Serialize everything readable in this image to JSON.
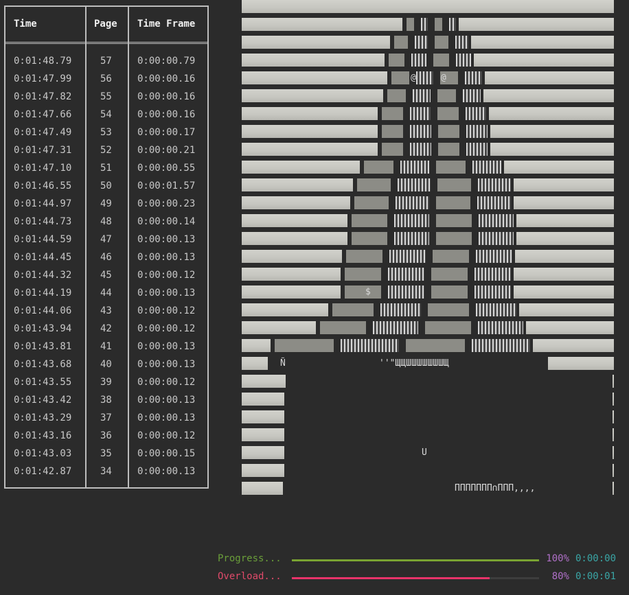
{
  "table": {
    "headers": {
      "time": "Time",
      "page": "Page",
      "frame": "Time Frame"
    },
    "rows": [
      {
        "time": "0:01:48.79",
        "page": "57",
        "frame": "0:00:00.79"
      },
      {
        "time": "0:01:47.99",
        "page": "56",
        "frame": "0:00:00.16"
      },
      {
        "time": "0:01:47.82",
        "page": "55",
        "frame": "0:00:00.16"
      },
      {
        "time": "0:01:47.66",
        "page": "54",
        "frame": "0:00:00.16"
      },
      {
        "time": "0:01:47.49",
        "page": "53",
        "frame": "0:00:00.17"
      },
      {
        "time": "0:01:47.31",
        "page": "52",
        "frame": "0:00:00.21"
      },
      {
        "time": "0:01:47.10",
        "page": "51",
        "frame": "0:00:00.55"
      },
      {
        "time": "0:01:46.55",
        "page": "50",
        "frame": "0:00:01.57"
      },
      {
        "time": "0:01:44.97",
        "page": "49",
        "frame": "0:00:00.23"
      },
      {
        "time": "0:01:44.73",
        "page": "48",
        "frame": "0:00:00.14"
      },
      {
        "time": "0:01:44.59",
        "page": "47",
        "frame": "0:00:00.13"
      },
      {
        "time": "0:01:44.45",
        "page": "46",
        "frame": "0:00:00.13"
      },
      {
        "time": "0:01:44.32",
        "page": "45",
        "frame": "0:00:00.12"
      },
      {
        "time": "0:01:44.19",
        "page": "44",
        "frame": "0:00:00.13"
      },
      {
        "time": "0:01:44.06",
        "page": "43",
        "frame": "0:00:00.12"
      },
      {
        "time": "0:01:43.94",
        "page": "42",
        "frame": "0:00:00.12"
      },
      {
        "time": "0:01:43.81",
        "page": "41",
        "frame": "0:00:00.13"
      },
      {
        "time": "0:01:43.68",
        "page": "40",
        "frame": "0:00:00.13"
      },
      {
        "time": "0:01:43.55",
        "page": "39",
        "frame": "0:00:00.12"
      },
      {
        "time": "0:01:43.42",
        "page": "38",
        "frame": "0:00:00.13"
      },
      {
        "time": "0:01:43.29",
        "page": "37",
        "frame": "0:00:00.13"
      },
      {
        "time": "0:01:43.16",
        "page": "36",
        "frame": "0:00:00.12"
      },
      {
        "time": "0:01:43.03",
        "page": "35",
        "frame": "0:00:00.15"
      },
      {
        "time": "0:01:42.87",
        "page": "34",
        "frame": "0:00:00.13"
      }
    ]
  },
  "progress": [
    {
      "label": "Progress...",
      "percent_text": "100%",
      "time": "0:00:00",
      "fraction": 1.0,
      "label_color": "#6a9e3a",
      "bar_color": "#7aa332"
    },
    {
      "label": "Overload...",
      "percent_text": "80%",
      "time": "0:00:01",
      "fraction": 0.8,
      "label_color": "#e04a6a",
      "bar_color": "#e8336a"
    }
  ],
  "art_glyphs": {
    "eyes": "@",
    "dollar": "$",
    "n_tilde": "Ñ",
    "u_letter": "U",
    "quote_row": "''\"ЩЩШШШШШШШЩ",
    "bottom_row": "ППППППП∩ППП,,,,"
  }
}
